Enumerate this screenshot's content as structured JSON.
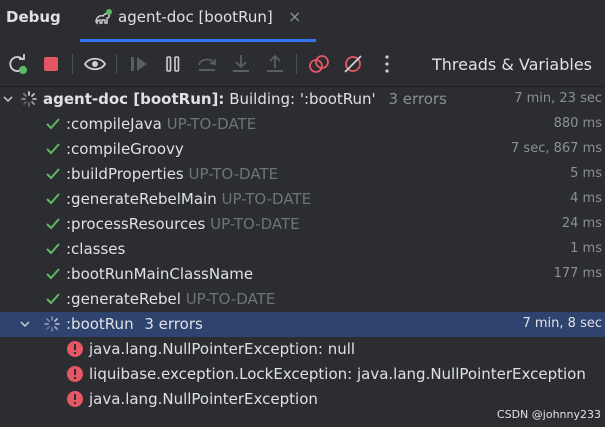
{
  "header": {
    "panel_title": "Debug",
    "tab_label": "agent-doc [bootRun]",
    "tab_close": "×"
  },
  "toolbar": {
    "buttons": [
      "rerun-icon",
      "stop-icon",
      "view-breakpoints-icon",
      "resume-icon",
      "pause-icon",
      "step-over-icon",
      "step-into-icon",
      "step-out-icon",
      "view-breakpoints-red-icon",
      "mute-breakpoints-icon",
      "more-icon"
    ],
    "threads_variables": "Threads & Variables"
  },
  "tree": {
    "root": {
      "name": "agent-doc [bootRun]:",
      "message": "Building: ':bootRun'",
      "errors": "3 errors",
      "duration": "7 min, 23 sec"
    },
    "tasks": [
      {
        "name": ":compileJava",
        "status": "UP-TO-DATE",
        "duration": "880 ms"
      },
      {
        "name": ":compileGroovy",
        "status": "",
        "duration": "7 sec, 867 ms"
      },
      {
        "name": ":buildProperties",
        "status": "UP-TO-DATE",
        "duration": "5 ms"
      },
      {
        "name": ":generateRebelMain",
        "status": "UP-TO-DATE",
        "duration": "4 ms"
      },
      {
        "name": ":processResources",
        "status": "UP-TO-DATE",
        "duration": "24 ms"
      },
      {
        "name": ":classes",
        "status": "",
        "duration": "1 ms"
      },
      {
        "name": ":bootRunMainClassName",
        "status": "",
        "duration": "177 ms"
      },
      {
        "name": ":generateRebel",
        "status": "UP-TO-DATE",
        "duration": ""
      }
    ],
    "bootrun": {
      "name": ":bootRun",
      "errors": "3 errors",
      "duration": "7 min, 8 sec"
    },
    "errors": [
      {
        "text": "java.lang.NullPointerException: null"
      },
      {
        "text": "liquibase.exception.LockException: java.lang.NullPointerException"
      },
      {
        "text": "java.lang.NullPointerException"
      }
    ]
  },
  "watermark": "CSDN @johnny233",
  "colors": {
    "background": "#2b2d30",
    "accent": "#3574f0",
    "success": "#5fb865",
    "error": "#e55765",
    "selection": "#2e436e"
  }
}
